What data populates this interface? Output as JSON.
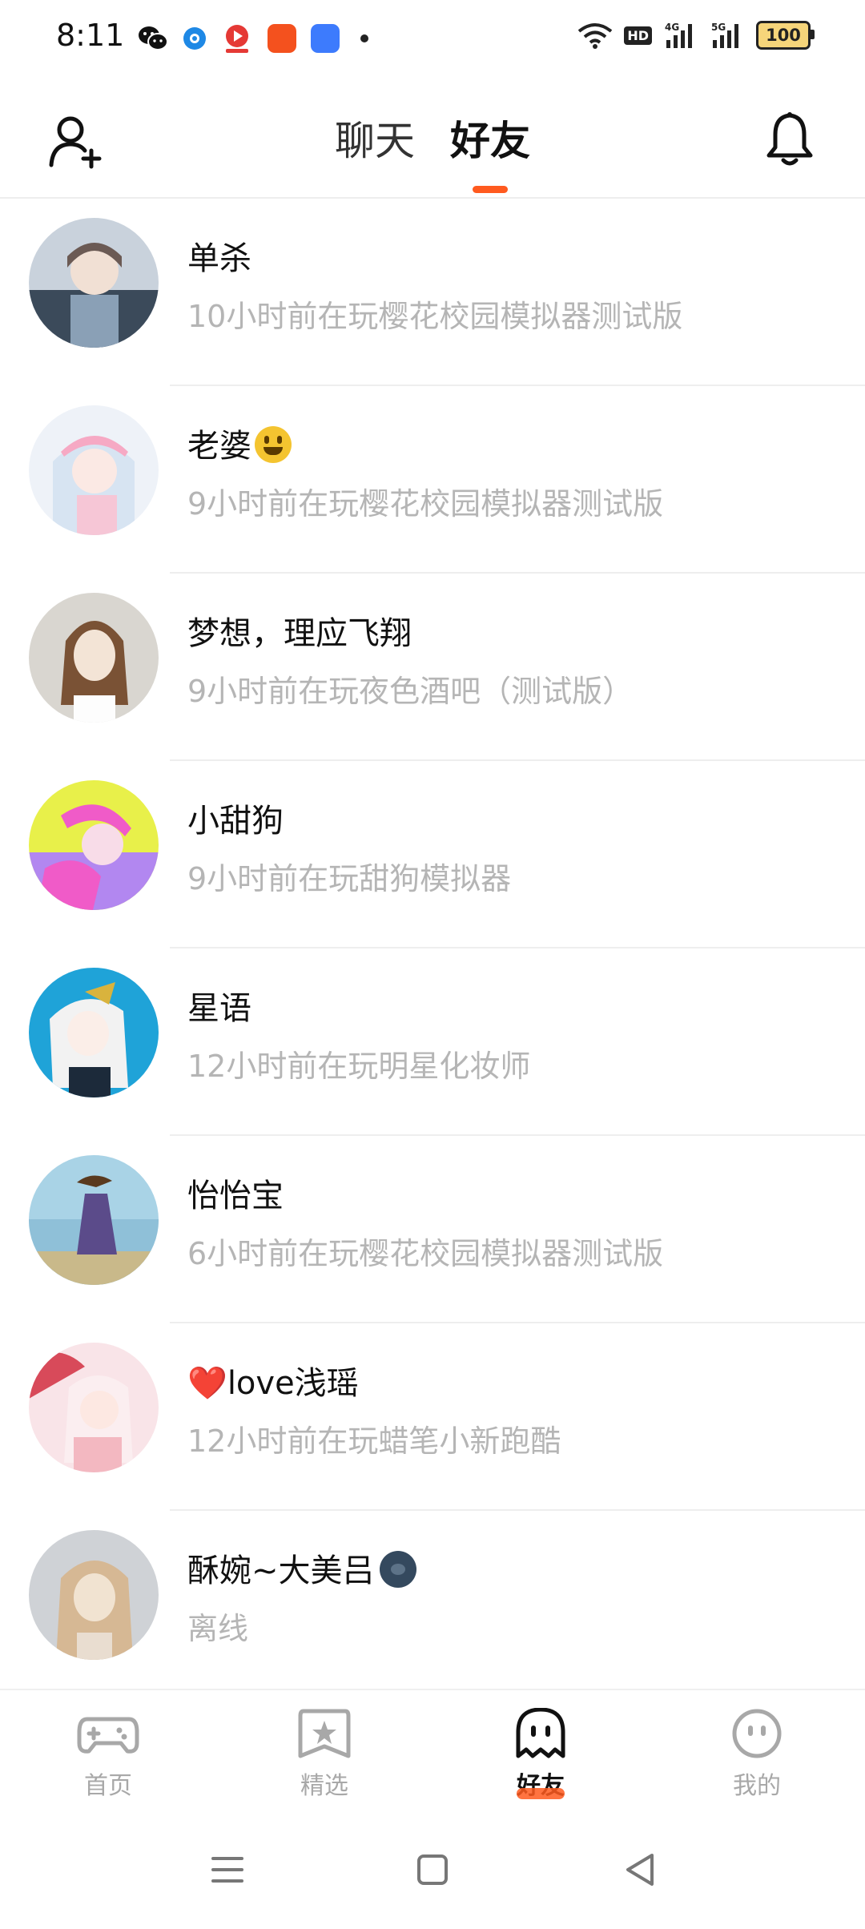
{
  "status_bar": {
    "time": "8:11",
    "left_icons": [
      "wechat-icon",
      "browser-icon",
      "video-app-icon",
      "shopping-app-icon",
      "chat-app-icon",
      "more-dot-icon"
    ],
    "network_hd": "HD",
    "network_4g": "4G",
    "network_5g": "5G",
    "battery": "100"
  },
  "header": {
    "tabs": [
      {
        "label": "聊天",
        "active": false
      },
      {
        "label": "好友",
        "active": true
      }
    ]
  },
  "friends": [
    {
      "name": "单杀",
      "status": "10小时前在玩樱花校园模拟器测试版",
      "avatar_colors": [
        "#3b4a5a",
        "#8aa0b6",
        "#c9d2dc"
      ]
    },
    {
      "name": "老婆",
      "status": "9小时前在玩樱花校园模拟器测试版",
      "avatar_colors": [
        "#f6c6d6",
        "#d7e4f2",
        "#ffffff"
      ],
      "suffix": "smile-emoji"
    },
    {
      "name": "梦想，理应飞翔",
      "status": "9小时前在玩夜色酒吧（测试版）",
      "avatar_colors": [
        "#d9d6d0",
        "#7a5235",
        "#f3e4d6"
      ]
    },
    {
      "name": "小甜狗",
      "status": "9小时前在玩甜狗模拟器",
      "avatar_colors": [
        "#e8f04a",
        "#f05bc8",
        "#b287f0"
      ]
    },
    {
      "name": "星语",
      "status": "12小时前在玩明星化妆师",
      "avatar_colors": [
        "#1fa3d8",
        "#f2f2f2",
        "#d9b33d"
      ]
    },
    {
      "name": "怡怡宝",
      "status": "6小时前在玩樱花校园模拟器测试版",
      "avatar_colors": [
        "#8fc0d8",
        "#5b4b8a",
        "#c9b98a"
      ]
    },
    {
      "name": "love浅瑶",
      "prefix": "❤️",
      "status": "12小时前在玩蜡笔小新跑酷",
      "avatar_colors": [
        "#f3b8c1",
        "#f9e4e8",
        "#d84a5a"
      ]
    },
    {
      "name": "酥婉~大美吕",
      "status": "离线",
      "avatar_colors": [
        "#cfd2d6",
        "#d6b894",
        "#f1e3d1"
      ],
      "suffix": "moon-emoji"
    }
  ],
  "bottom_nav": [
    {
      "label": "首页",
      "icon": "gamepad-icon",
      "active": false
    },
    {
      "label": "精选",
      "icon": "star-bookmark-icon",
      "active": false
    },
    {
      "label": "好友",
      "icon": "ghost-icon",
      "active": true
    },
    {
      "label": "我的",
      "icon": "face-icon",
      "active": false
    }
  ],
  "colors": {
    "accent": "#ff5a1f",
    "muted_text": "#b5b5b5",
    "separator": "#eeeeee"
  }
}
